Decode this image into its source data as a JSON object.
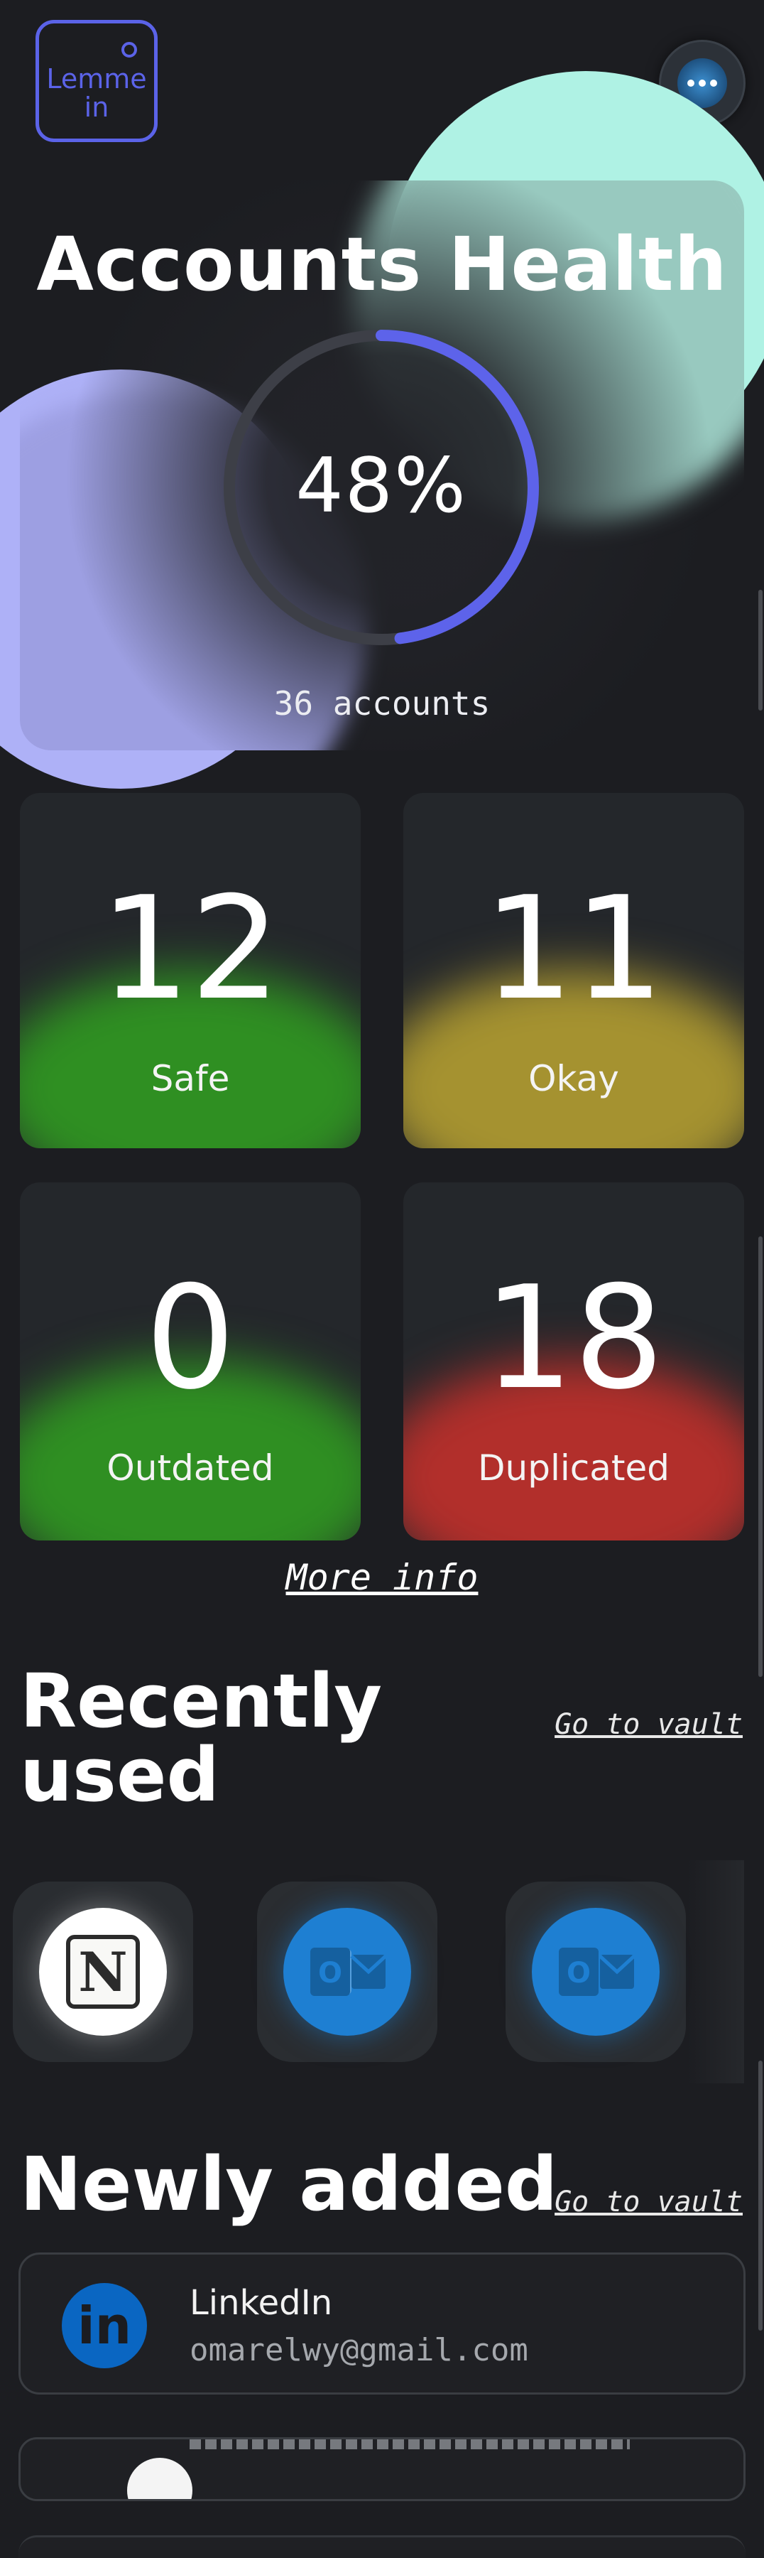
{
  "header": {
    "logo_text": "Lemme\nin"
  },
  "health": {
    "title": "Accounts Health",
    "percent_label": "48%",
    "percent_value": 48,
    "accounts_label": "36 accounts"
  },
  "stats": [
    {
      "value": "12",
      "label": "Safe",
      "color": "#2f8f22"
    },
    {
      "value": "11",
      "label": "Okay",
      "color": "#a59230"
    },
    {
      "value": "0",
      "label": "Outdated",
      "color": "#2f8f22"
    },
    {
      "value": "18",
      "label": "Duplicated",
      "color": "#b22f2b"
    }
  ],
  "more_info": "More info",
  "recently_used": {
    "title": "Recently used",
    "vault_link": "Go to vault",
    "apps": [
      {
        "name": "Notion",
        "icon": "notion-icon"
      },
      {
        "name": "Outlook",
        "icon": "outlook-icon"
      },
      {
        "name": "Outlook",
        "icon": "outlook-icon"
      }
    ]
  },
  "newly_added": {
    "title": "Newly added",
    "vault_link": "Go to vault",
    "items": [
      {
        "name": "LinkedIn",
        "email": "omarelwy@gmail.com",
        "icon": "linkedin-icon"
      }
    ]
  },
  "colors": {
    "background": "#1c1d21",
    "accent": "#5b63e8",
    "mint": "#aff2e4",
    "lavender": "#aeb1f7"
  }
}
